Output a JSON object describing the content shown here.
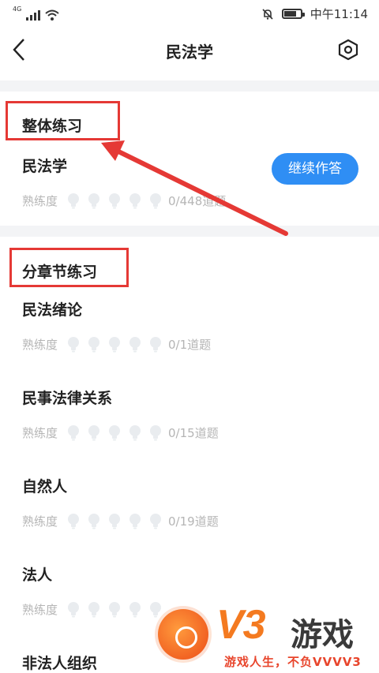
{
  "status_bar": {
    "network": "4G",
    "time": "中午11:14",
    "battery_level": 0.75
  },
  "nav": {
    "title": "民法学"
  },
  "overall": {
    "section_title": "整体练习",
    "item_title": "民法学",
    "continue_label": "继续作答",
    "progress_label": "熟练度",
    "progress_count": "0/448道题"
  },
  "chapters": {
    "section_title": "分章节练习",
    "items": [
      {
        "title": "民法绪论",
        "progress_label": "熟练度",
        "progress_count": "0/1道题"
      },
      {
        "title": "民事法律关系",
        "progress_label": "熟练度",
        "progress_count": "0/15道题"
      },
      {
        "title": "自然人",
        "progress_label": "熟练度",
        "progress_count": "0/19道题"
      },
      {
        "title": "法人",
        "progress_label": "熟练度",
        "progress_count": ""
      },
      {
        "title": "非法人组织",
        "progress_label": "",
        "progress_count": ""
      }
    ]
  },
  "watermark": {
    "logo_text": "V3",
    "brand": "游戏",
    "slogan": "游戏人生，不负VVVV3"
  },
  "colors": {
    "accent": "#2f8ef4",
    "highlight": "#e53935",
    "muted": "#b5b5b5"
  }
}
